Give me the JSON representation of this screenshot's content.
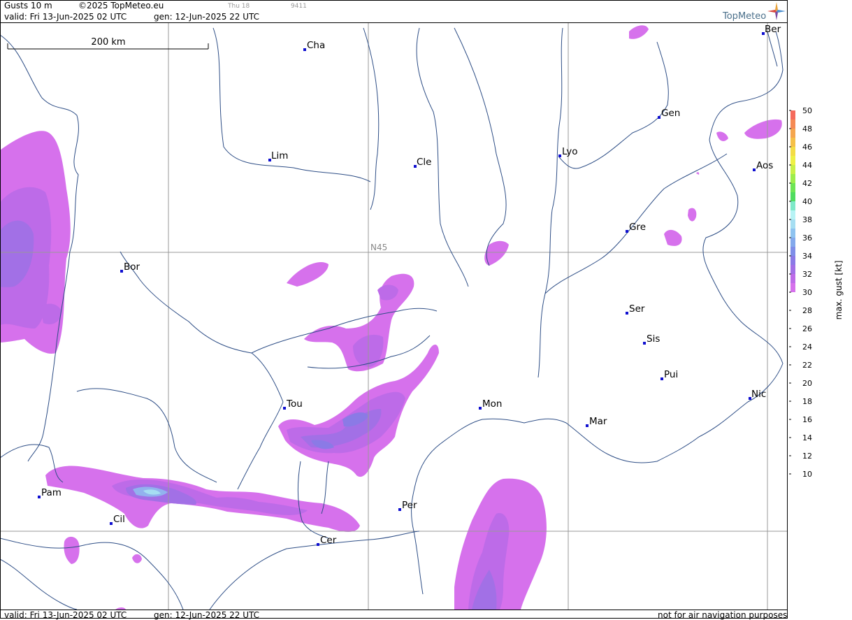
{
  "header": {
    "title": "Gusts 10 m",
    "copyright": "©2025 TopMeteo.eu",
    "day": "Thu 18",
    "code": "9411",
    "valid_line": "valid:  Fri  13-Jun-2025  02 UTC",
    "gen_line": "gen: 12-Jun-2025 22 UTC"
  },
  "footer": {
    "valid_line": "valid:  Fri  13-Jun-2025  02 UTC",
    "gen_line": "gen: 12-Jun-2025 22 UTC",
    "disclaimer": "not for air navigation purposes"
  },
  "logo": {
    "text": "TopMeteo"
  },
  "map": {
    "scale_bar": "200 km",
    "grid_label": "N45",
    "cities": [
      "Ber",
      "Cha",
      "Gen",
      "Lim",
      "Cle",
      "Lyo",
      "Aos",
      "Gre",
      "Bor",
      "Ser",
      "Sis",
      "Pui",
      "Tou",
      "Mon",
      "Nic",
      "Mar",
      "Pam",
      "Per",
      "Cil",
      "Cer"
    ]
  },
  "legend": {
    "title": "max. gust  [kt]",
    "ticks": [
      "50",
      "48",
      "46",
      "44",
      "42",
      "40",
      "38",
      "36",
      "34",
      "32",
      "30",
      "28",
      "26",
      "24",
      "22",
      "20",
      "18",
      "16",
      "14",
      "12",
      "10"
    ],
    "colors": [
      "#f56b5c",
      "#f58a55",
      "#f5a64f",
      "#f5c048",
      "#f3dc45",
      "#eef045",
      "#c9f048",
      "#9ded4c",
      "#6fe555",
      "#50dc60",
      "#7fe9c9",
      "#b7f3f5",
      "#a6def2",
      "#8ec3f0",
      "#83a9ec",
      "#7f8ee8",
      "#8b7ae6",
      "#a270e6",
      "#bd6be8",
      "#d671ec"
    ]
  }
}
